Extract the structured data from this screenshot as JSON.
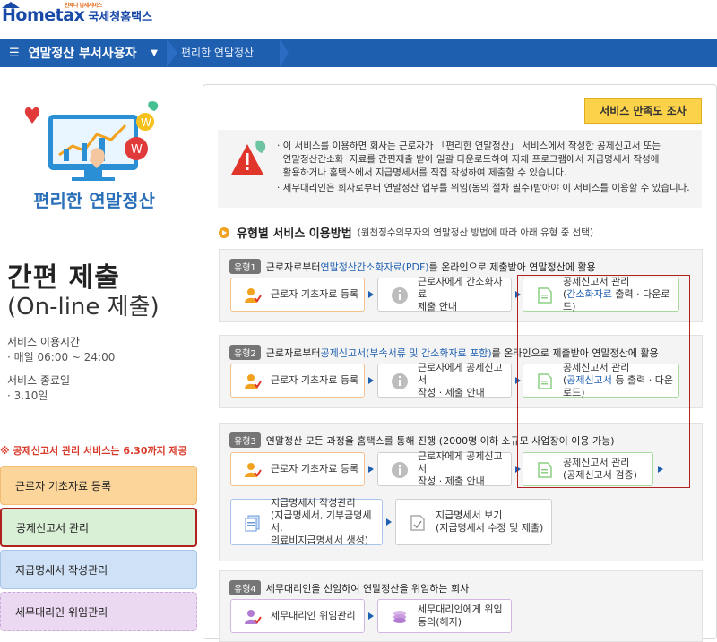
{
  "header": {
    "logo_text": "Hometax",
    "logo_tagline": "언제나 납세서비스",
    "logo_sub": "국세청홈택스",
    "menu_label": "연말정산 부서사용자",
    "breadcrumb": "편리한 연말정산"
  },
  "left": {
    "hero_title": "편리한 연말정산",
    "big_title": "간편 제출",
    "big_subtitle": "(On-line 제출)",
    "service_time_label": "서비스 이용시간",
    "service_time_value": "· 매일 06:00 ~ 24:00",
    "service_end_label": "서비스 종료일",
    "service_end_value": "· 3.10일",
    "notice": "※ 공제신고서 관리 서비스는 6.30까지 제공",
    "buttons": [
      "근로자 기초자료 등록",
      "공제신고서 관리",
      "지급명세서 작성관리",
      "세무대리인 위임관리"
    ]
  },
  "main": {
    "survey_button": "서비스 만족도 조사",
    "warning_lines": [
      "· 이 서비스를 이용하면 회사는 근로자가 「편리한 연말정산」 서비스에서 작성한 공제신고서 또는",
      "  연말정산간소화  자료를 간편제출 받아 일괄 다운로드하여 자체 프로그램에서 지급명세서 작성에",
      "  활용하거나 홈택스에서 지급명세서를 직접 작성하여 제출할 수 있습니다.",
      "· 세무대리인은 회사로부터 연말정산 업무를 위임(동의 절차 필수)받아야 이 서비스를 이용할 수 있습니다."
    ],
    "section_title": "유형별 서비스 이용방법",
    "section_sub": "(원천징수의무자의 연말정산 방법에 따라 아래 유형 중 선택)",
    "type1": {
      "badge": "유형1",
      "desc_pre": "근로자로부터 ",
      "desc_hl": "연말정산간소화자료(PDF)",
      "desc_post": "를 온라인으로 제출받아 연말정산에 활용",
      "card1": "근로자 기초자료 등록",
      "card2_line1": "근로자에게 간소화자료",
      "card2_line2": "제출 안내",
      "card3_line1": "공제신고서 관리",
      "card3_hl": "간소화자료",
      "card3_line2_pre": "(",
      "card3_line2_post": " 출력 · 다운로드)"
    },
    "type2": {
      "badge": "유형2",
      "desc_pre": "근로자로부터 ",
      "desc_hl": "공제신고서(부속서류 및 간소화자료 포함)",
      "desc_post": "를 온라인으로 제출받아 연말정산에 활용",
      "card1": "근로자 기초자료 등록",
      "card2_line1": "근로자에게 공제신고서",
      "card2_line2": "작성 · 제출 안내",
      "card3_line1": "공제신고서 관리",
      "card3_hl": "공제신고서",
      "card3_line2_pre": "(",
      "card3_line2_post": " 등 출력 · 다운로드)"
    },
    "type3": {
      "badge": "유형3",
      "desc": "연말정산 모든 과정을 홈택스를 통해 진행 (2000명 이하 소규모 사업장이 이용 가능)",
      "card1": "근로자 기초자료 등록",
      "card2_line1": "근로자에게 공제신고서",
      "card2_line2": "작성 · 제출 안내",
      "card3_line1": "공제신고서 관리",
      "card3_line2": "(공제신고서 검증)",
      "card4_line1": "지급명세서 작성관리",
      "card4_line2": "(지급명세서, 기부금명세서,",
      "card4_line3": "의료비지급명세서 생성)",
      "card5_line1": "지급명세서 보기",
      "card5_line2": "(지급명세서 수정 및 제출)"
    },
    "type4": {
      "badge": "유형4",
      "desc": "세무대리인을 선임하여 연말정산을 위임하는 회사",
      "card1": "세무대리인 위임관리",
      "card2_line1": "세무대리인에게 위임",
      "card2_line2": "동의(해지)"
    }
  },
  "colors": {
    "brand_blue": "#1f5fb0",
    "accent_orange": "#f2a221",
    "alert_red": "#b0221f",
    "survey_yellow": "#fbd24a"
  }
}
